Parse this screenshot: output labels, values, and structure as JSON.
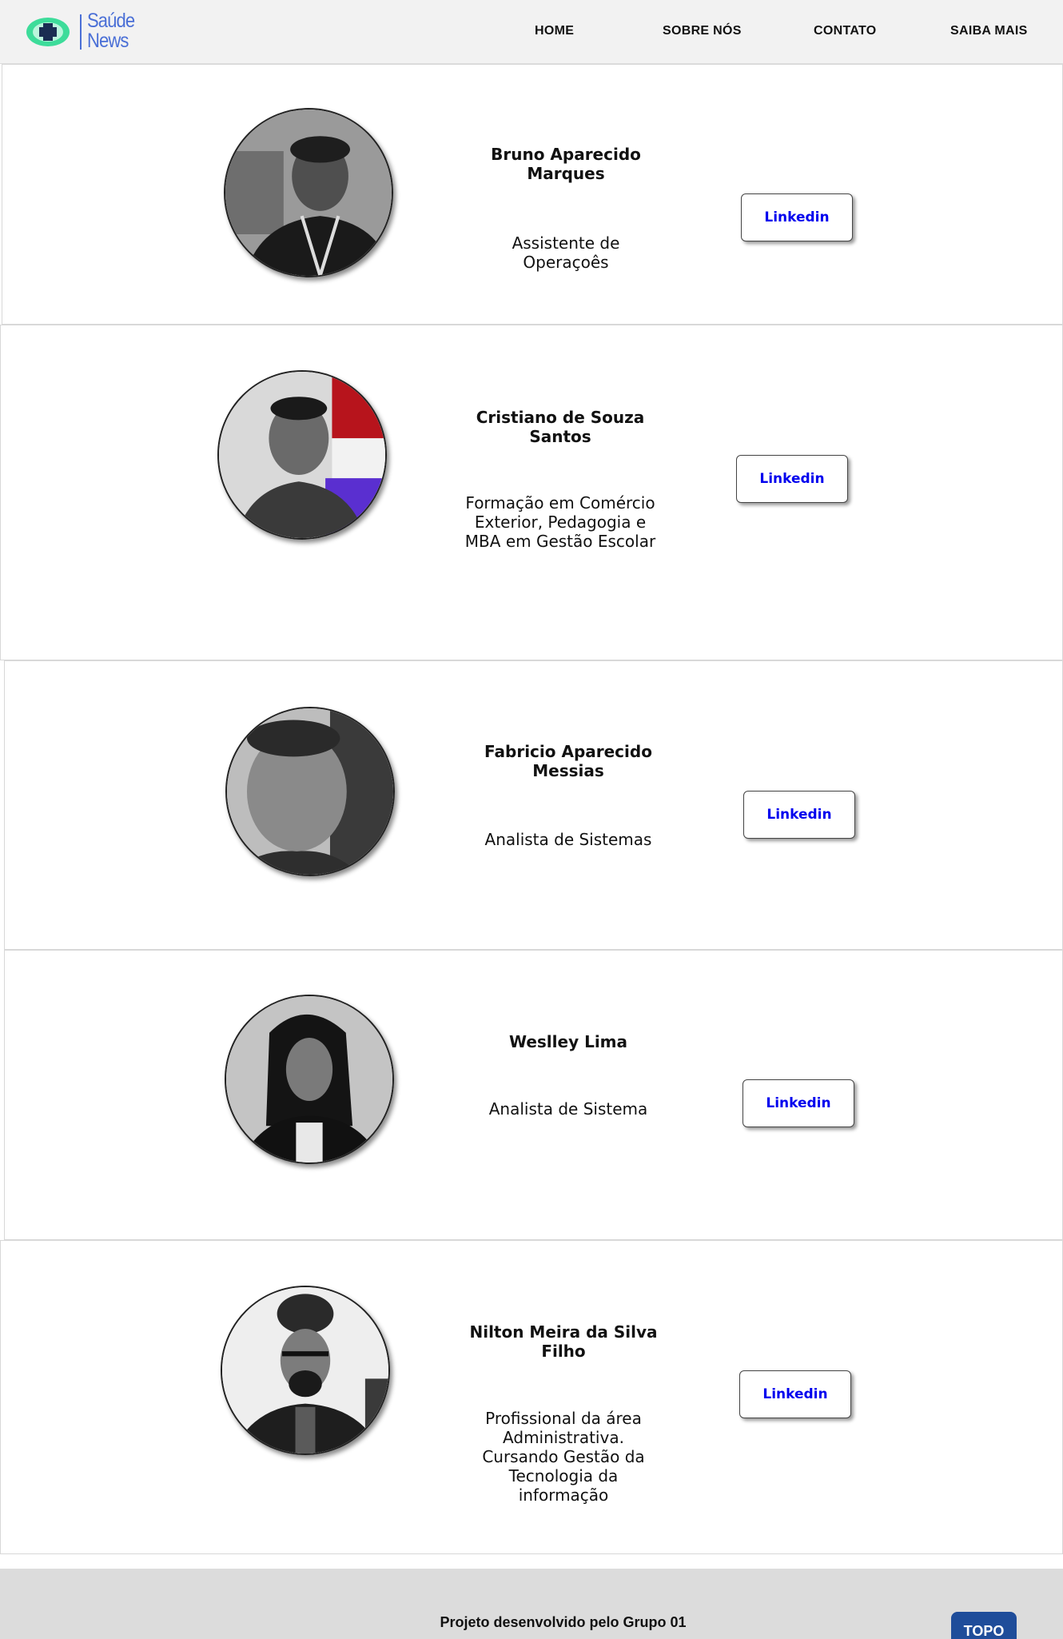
{
  "header": {
    "logo": {
      "line1": "Saúde",
      "line2": "News",
      "icon": "cross-eye-icon"
    },
    "nav": [
      "HOME",
      "SOBRE NÓS",
      "CONTATO",
      "SAIBA MAIS"
    ]
  },
  "members": [
    {
      "name": "Bruno Aparecido Marques",
      "role": "Assistente de Operaçoês",
      "button": "Linkedin"
    },
    {
      "name": "Cristiano de Souza Santos",
      "role": "Formação em Comércio Exterior, Pedagogia e MBA em Gestão Escolar",
      "button": "Linkedin"
    },
    {
      "name": "Fabricio Aparecido Messias",
      "role": "Analista de Sistemas",
      "button": "Linkedin"
    },
    {
      "name": "Weslley Lima",
      "role": "Analista de Sistema",
      "button": "Linkedin"
    },
    {
      "name": "Nilton Meira da Silva Filho",
      "role": "Profissional da área Administrativa. Cursando Gestão da Tecnologia da informação",
      "button": "Linkedin"
    }
  ],
  "footer": {
    "text": "Projeto desenvolvido pelo Grupo 01",
    "top_button": "TOPO"
  },
  "colors": {
    "brand": "#4a6fd6",
    "logo_green": "#3ddc9a",
    "link": "#0000ee",
    "top_button": "#1f4d9a"
  }
}
